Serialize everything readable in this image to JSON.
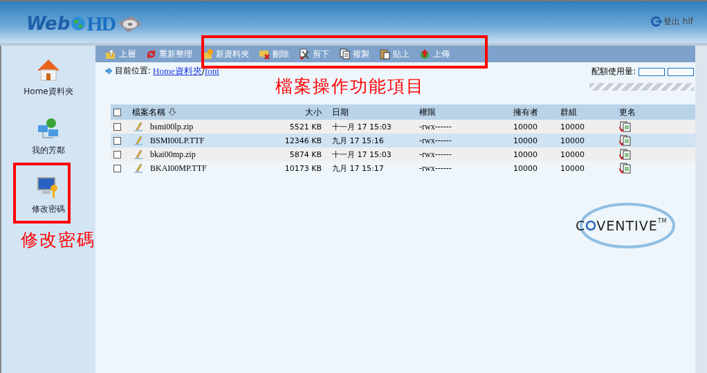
{
  "header": {
    "logo": {
      "part_1": "Web",
      "part_2": "HD"
    },
    "logout": "登出 hlf"
  },
  "sidebar": {
    "items": [
      {
        "label": "Home資料夾",
        "kind": "home"
      },
      {
        "label": "我的芳鄰",
        "kind": "network"
      },
      {
        "label": "修改密碼",
        "kind": "password"
      }
    ]
  },
  "toolbar": {
    "items": [
      {
        "label": "上層",
        "kind": "up"
      },
      {
        "label": "重新整理",
        "kind": "refresh"
      },
      {
        "label": "新資料夾",
        "kind": "newfolder"
      },
      {
        "label": "刪除",
        "kind": "delete"
      },
      {
        "label": "剪下",
        "kind": "cut"
      },
      {
        "label": "複製",
        "kind": "copy"
      },
      {
        "label": "貼上",
        "kind": "paste"
      },
      {
        "label": "上傳",
        "kind": "upload"
      }
    ]
  },
  "location": {
    "label": "目前位置:",
    "path": [
      "Home資料夾",
      "font"
    ],
    "separator": "/"
  },
  "quota": {
    "label": "配額使用量:"
  },
  "table": {
    "columns": [
      "檔案名稱",
      "大小",
      "日期",
      "權限",
      "擁有者",
      "群組",
      "更名"
    ],
    "header_checked": false,
    "rows": [
      {
        "checked": false,
        "highlighted": false,
        "name": "bsmi00lp.zip",
        "size": "5521 KB",
        "date": "十一月 17 15:03",
        "permissions": "-rwx------",
        "owner": "10000",
        "group": "10000"
      },
      {
        "checked": false,
        "highlighted": true,
        "name": "BSMI00LP.TTF",
        "size": "12346 KB",
        "date": "九月 17 15:16",
        "permissions": "-rwx------",
        "owner": "10000",
        "group": "10000"
      },
      {
        "checked": false,
        "highlighted": false,
        "name": "bkai00mp.zip",
        "size": "5874 KB",
        "date": "十一月 17 15:03",
        "permissions": "-rwx------",
        "owner": "10000",
        "group": "10000"
      },
      {
        "checked": false,
        "highlighted": false,
        "name": "BKAI00MP.TTF",
        "size": "10173 KB",
        "date": "九月 17 15:17",
        "permissions": "-rwx------",
        "owner": "10000",
        "group": "10000"
      }
    ]
  },
  "brand": {
    "before": "C",
    "after": "VENTIVE",
    "mark": "TM"
  },
  "annotations": [
    {
      "text": "檔案操作功能項目",
      "kind": "toolbar"
    },
    {
      "text": "修改密碼",
      "kind": "sidebar"
    }
  ]
}
